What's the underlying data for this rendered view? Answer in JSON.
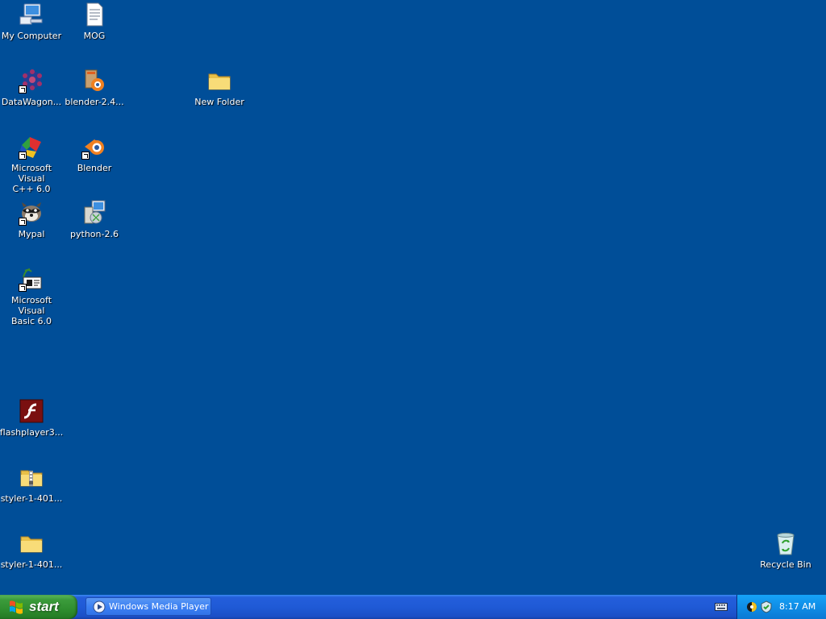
{
  "desktop": {
    "background_color": "#004e98",
    "icons": {
      "my_computer": {
        "label": "My Computer",
        "icon": "my-computer-icon"
      },
      "mog": {
        "label": "MOG",
        "icon": "text-document-icon"
      },
      "datawagon": {
        "label": "DataWagon...",
        "icon": "datawagon-icon",
        "shortcut": true
      },
      "blender_installer": {
        "label": "blender-2.4...",
        "icon": "blender-installer-icon"
      },
      "new_folder": {
        "label": "New Folder",
        "icon": "folder-icon"
      },
      "msvc": {
        "label": "Microsoft Visual\nC++ 6.0",
        "icon": "visual-cpp-icon",
        "shortcut": true
      },
      "blender": {
        "label": "Blender",
        "icon": "blender-icon",
        "shortcut": true
      },
      "mypal": {
        "label": "Mypal",
        "icon": "mypal-icon",
        "shortcut": true
      },
      "python": {
        "label": "python-2.6",
        "icon": "python-installer-icon"
      },
      "msvb": {
        "label": "Microsoft Visual\nBasic 6.0",
        "icon": "visual-basic-icon",
        "shortcut": true
      },
      "flashplayer": {
        "label": "flashplayer3...",
        "icon": "flash-icon"
      },
      "styler_zip": {
        "label": "styler-1-401...",
        "icon": "zip-folder-icon"
      },
      "styler_folder": {
        "label": "styler-1-401...",
        "icon": "folder-icon"
      },
      "recycle_bin": {
        "label": "Recycle Bin",
        "icon": "recycle-bin-icon"
      }
    }
  },
  "taskbar": {
    "start_label": "start",
    "task": {
      "label": "Windows Media Player",
      "icon": "media-player-icon"
    },
    "tray": {
      "time": "8:17 AM",
      "icons": [
        "network-icon",
        "shield-icon"
      ]
    }
  }
}
